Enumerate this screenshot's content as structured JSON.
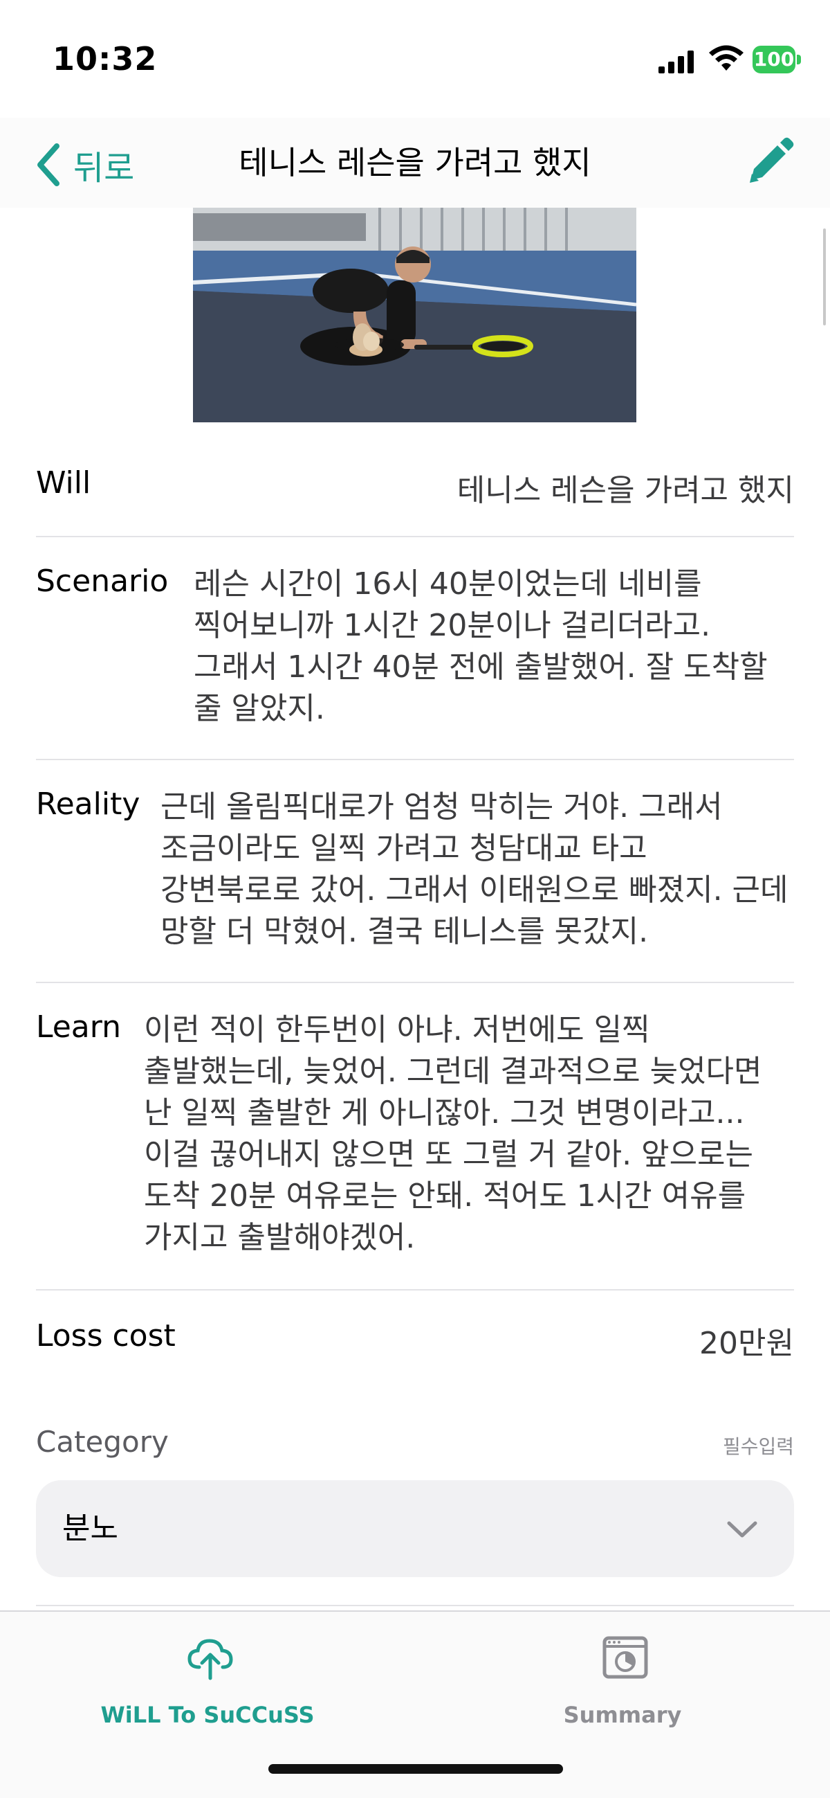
{
  "status_bar": {
    "time": "10:32",
    "battery": "100"
  },
  "nav": {
    "back_label": "뒤로",
    "title": "테니스 레슨을 가려고 했지"
  },
  "photo": {
    "description_icon": "photo-thumbnail"
  },
  "fields": {
    "will": {
      "label": "Will",
      "value": "테니스 레슨을 가려고 했지"
    },
    "scenario": {
      "label": "Scenario",
      "value": "레슨 시간이 16시 40분이었는데 네비를 찍어보니까 1시간 20분이나 걸리더라고. 그래서 1시간 40분 전에 출발했어. 잘 도착할 줄 알았지."
    },
    "reality": {
      "label": "Reality",
      "value": "근데 올림픽대로가 엄청 막히는 거야. 그래서 조금이라도 일찍 가려고 청담대교 타고 강변북로로 갔어. 그래서 이태원으로 빠졌지. 근데 망할 더 막혔어. 결국 테니스를 못갔지."
    },
    "learn": {
      "label": "Learn",
      "value": "이런 적이 한두번이 아냐. 저번에도 일찍 출발했는데, 늦었어. 그런데 결과적으로 늦었다면 난 일찍 출발한 게 아니잖아. 그것 변명이라고...이걸 끊어내지 않으면 또 그럴 거 같아. 앞으로는 도착 20분 여유로는 안돼. 적어도 1시간 여유를 가지고 출발해야겠어."
    },
    "loss_cost": {
      "label": "Loss cost",
      "value": "20만원"
    }
  },
  "category": {
    "label": "Category",
    "required_text": "필수입력",
    "selected": "분노"
  },
  "tabs": [
    {
      "label": "WiLL To SuCCuSS",
      "icon": "cloud-upload-icon",
      "active": true
    },
    {
      "label": "Summary",
      "icon": "summary-window-icon",
      "active": false
    }
  ],
  "colors": {
    "accent": "#1f9e8f",
    "inactive": "#8e8e93",
    "battery": "#34c759"
  }
}
